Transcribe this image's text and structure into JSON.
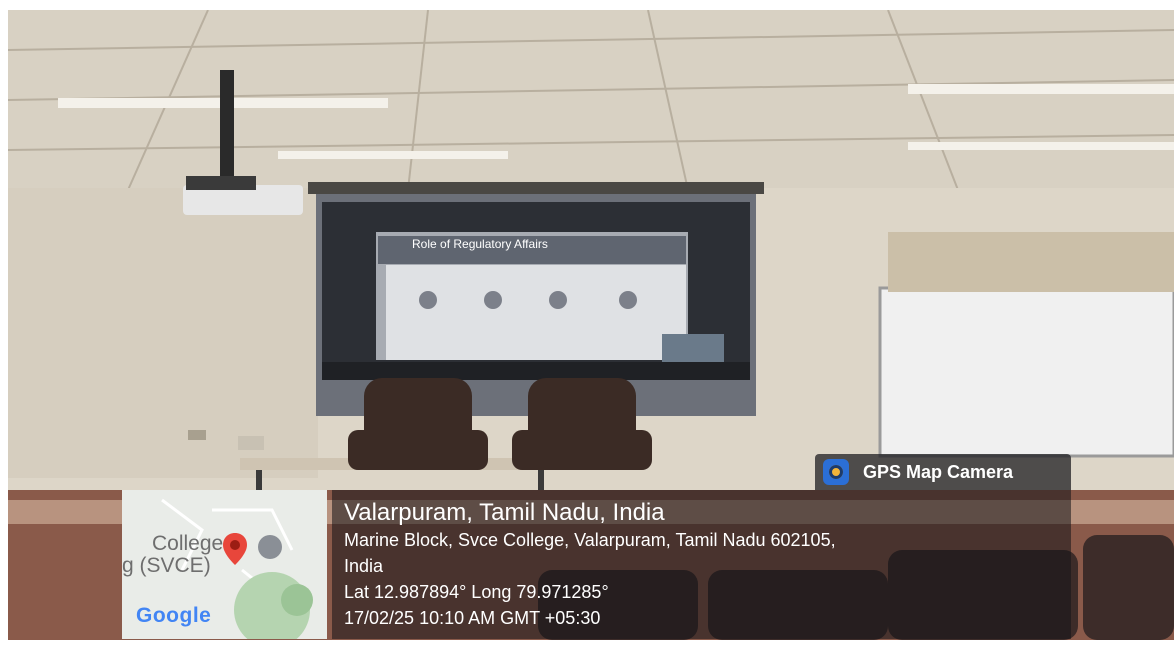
{
  "photo": {
    "scene": "lecture room with projector screen, two chairs and a whiteboard",
    "slide_title": "Role of Regulatory Affairs",
    "colors": {
      "wall": "#ddd6c8",
      "ceiling": "#cfc8bb",
      "screen": "#c8ccd3",
      "chairs": "#3a2a24",
      "floor": "#8a5a4a"
    }
  },
  "gps_badge": {
    "label": "GPS Map Camera",
    "icon": "gps-camera-icon"
  },
  "map_thumb": {
    "label_line1": "College",
    "label_line2": "g (SVCE)",
    "brand": "Google",
    "pin_icon": "map-pin-icon"
  },
  "location": {
    "title": "Valarpuram, Tamil Nadu, India",
    "address_line1": "Marine Block, Svce College, Valarpuram, Tamil Nadu 602105,",
    "address_line2": "India",
    "coords": "Lat 12.987894° Long 79.971285°",
    "datetime": "17/02/25 10:10 AM GMT +05:30"
  }
}
